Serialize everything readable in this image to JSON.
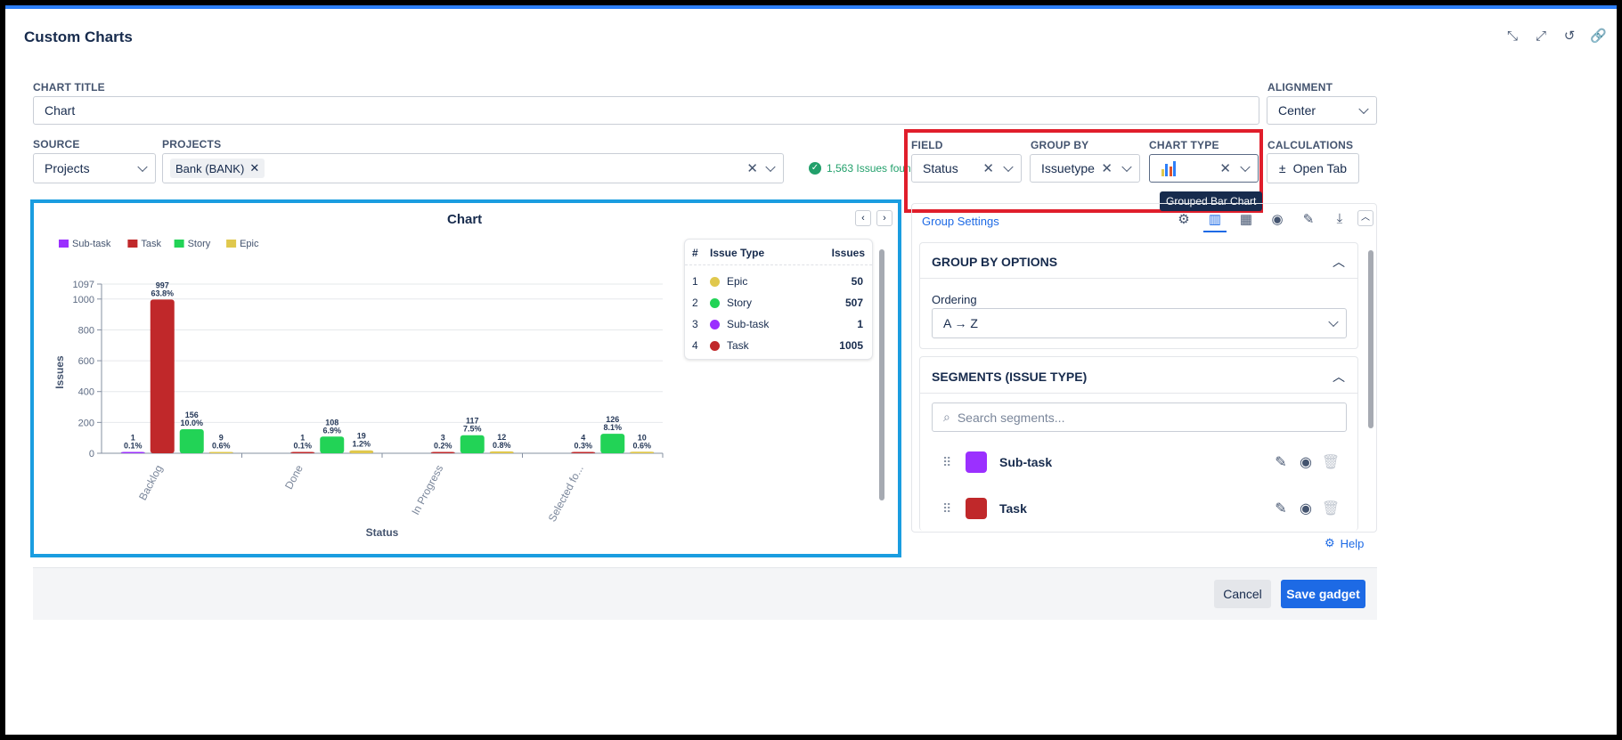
{
  "dialog": {
    "title": "Custom Charts",
    "header_icons": [
      "collapse-icon",
      "shrink-icon",
      "reset-icon",
      "link-icon"
    ]
  },
  "chart_title": {
    "label": "CHART TITLE",
    "value": "Chart"
  },
  "alignment": {
    "label": "ALIGNMENT",
    "value": "Center"
  },
  "source": {
    "label": "SOURCE",
    "value": "Projects"
  },
  "projects": {
    "label": "PROJECTS",
    "tag": "Bank (BANK)"
  },
  "issues_found": "1,563 Issues found",
  "field": {
    "label": "FIELD",
    "value": "Status"
  },
  "group_by": {
    "label": "GROUP BY",
    "value": "Issuetype"
  },
  "chart_type": {
    "label": "CHART TYPE",
    "tooltip": "Grouped Bar Chart"
  },
  "calculations": {
    "label": "CALCULATIONS",
    "button": "Open Tab"
  },
  "settings_panel": {
    "title": "Group Settings",
    "group_by_options": {
      "header": "GROUP BY OPTIONS",
      "ordering_label": "Ordering",
      "ordering_value": "A → Z"
    },
    "segments": {
      "header": "SEGMENTS (ISSUE TYPE)",
      "search_placeholder": "Search segments...",
      "items": [
        {
          "label": "Sub-task",
          "color": "#9b30ff"
        },
        {
          "label": "Task",
          "color": "#c0282a"
        }
      ]
    },
    "help": "Help"
  },
  "legend_table": {
    "headers": [
      "#",
      "Issue Type",
      "Issues"
    ],
    "rows": [
      {
        "num": "1",
        "type": "Epic",
        "issues": "50",
        "color": "#e0c84d"
      },
      {
        "num": "2",
        "type": "Story",
        "issues": "507",
        "color": "#22d356"
      },
      {
        "num": "3",
        "type": "Sub-task",
        "issues": "1",
        "color": "#9b30ff"
      },
      {
        "num": "4",
        "type": "Task",
        "issues": "1005",
        "color": "#c0282a"
      }
    ]
  },
  "footer": {
    "cancel": "Cancel",
    "save": "Save gadget"
  },
  "chart_data": {
    "type": "bar",
    "title": "Chart",
    "xlabel": "Status",
    "ylabel": "Issues",
    "ylim": [
      0,
      1097
    ],
    "yticks": [
      "0",
      "200",
      "400",
      "600",
      "800",
      "1000",
      "1097"
    ],
    "categories": [
      "Backlog",
      "Done",
      "In Progress",
      "Selected fo..."
    ],
    "legend_position": "top-left",
    "series": [
      {
        "name": "Sub-task",
        "color": "#9b30ff",
        "values": [
          1,
          0,
          0,
          0
        ],
        "labels": [
          [
            "1",
            "0.1%"
          ],
          null,
          null,
          null
        ]
      },
      {
        "name": "Task",
        "color": "#c0282a",
        "values": [
          997,
          1,
          3,
          4
        ],
        "labels": [
          [
            "997",
            "63.8%"
          ],
          [
            "1",
            "0.1%"
          ],
          [
            "3",
            "0.2%"
          ],
          [
            "4",
            "0.3%"
          ]
        ]
      },
      {
        "name": "Story",
        "color": "#22d356",
        "values": [
          156,
          108,
          117,
          126
        ],
        "labels": [
          [
            "156",
            "10.0%"
          ],
          [
            "108",
            "6.9%"
          ],
          [
            "117",
            "7.5%"
          ],
          [
            "126",
            "8.1%"
          ]
        ]
      },
      {
        "name": "Epic",
        "color": "#e0c84d",
        "values": [
          9,
          19,
          12,
          10
        ],
        "labels": [
          [
            "9",
            "0.6%"
          ],
          [
            "19",
            "1.2%"
          ],
          [
            "12",
            "0.8%"
          ],
          [
            "10",
            "0.6%"
          ]
        ]
      }
    ]
  }
}
